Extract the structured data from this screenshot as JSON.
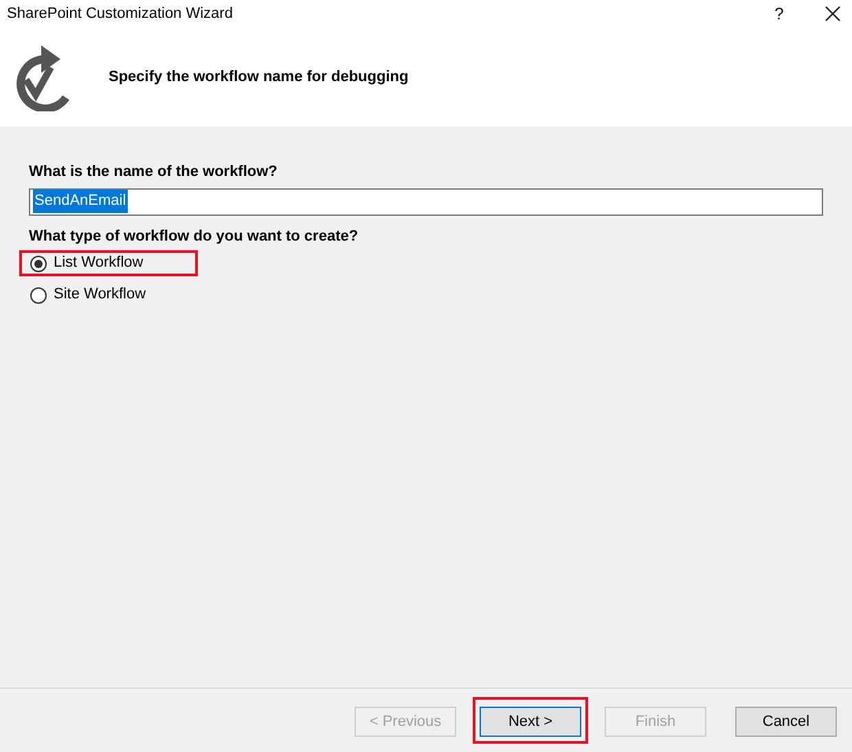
{
  "window": {
    "title": "SharePoint Customization Wizard",
    "help": "?"
  },
  "header": {
    "heading": "Specify the workflow name for debugging"
  },
  "name_field": {
    "label": "What is the name of the workflow?",
    "value": "SendAnEmail",
    "text_selected": true
  },
  "type_group": {
    "label": "What type of workflow do you want to create?",
    "options": [
      {
        "label": "List Workflow",
        "selected": true,
        "highlighted": true
      },
      {
        "label": "Site Workflow",
        "selected": false,
        "highlighted": false
      }
    ]
  },
  "buttons": [
    {
      "label": "< Previous",
      "disabled": true,
      "default": false,
      "highlighted": false
    },
    {
      "label": "Next >",
      "disabled": false,
      "default": true,
      "highlighted": true
    },
    {
      "label": "Finish",
      "disabled": true,
      "default": false,
      "highlighted": false
    },
    {
      "label": "Cancel",
      "disabled": false,
      "default": false,
      "highlighted": false
    }
  ]
}
